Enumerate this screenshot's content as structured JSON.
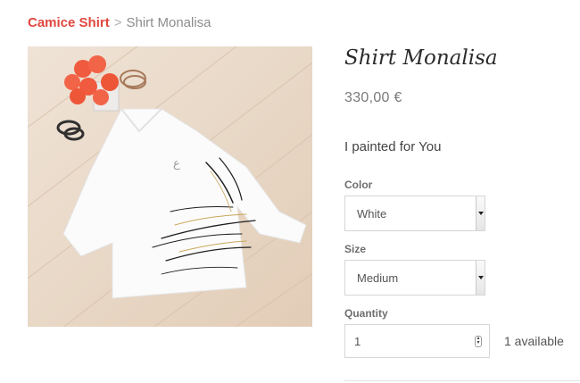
{
  "breadcrumb": {
    "parent": "Camice Shirt",
    "separator": ">",
    "current": "Shirt Monalisa"
  },
  "product": {
    "title": "Shirt Monalisa",
    "price": "330,00 €",
    "description": "I painted for You",
    "image_alt": "White shirt with black and gold paint strokes on a wooden floor"
  },
  "options": {
    "color_label": "Color",
    "color_value": "White",
    "size_label": "Size",
    "size_value": "Medium",
    "quantity_label": "Quantity",
    "quantity_value": "1",
    "availability": "1 available"
  },
  "colors": {
    "breadcrumb_link": "#e0473e",
    "title": "#2b2b2b",
    "price": "#7a7a7a",
    "border": "#d6d6d6"
  }
}
